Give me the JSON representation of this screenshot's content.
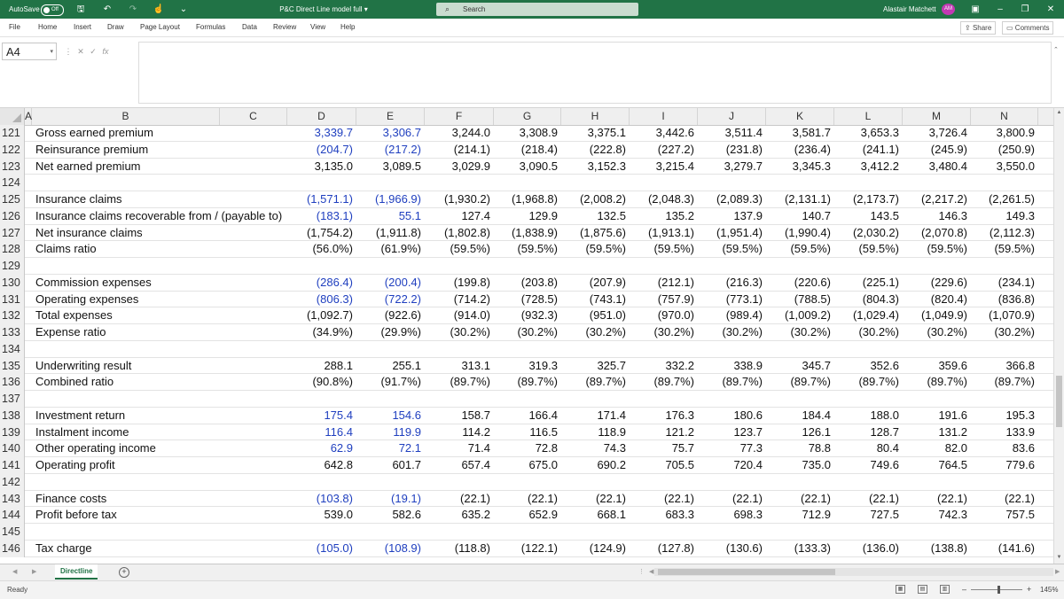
{
  "titlebar": {
    "autosave_label": "AutoSave",
    "autosave_state": "Off",
    "doc_title": "P&C Direct Line model full",
    "doc_title_caret": "▾",
    "search_placeholder": "Search",
    "user_name": "Alastair Matchett",
    "user_initials": "AM"
  },
  "menu": {
    "tabs": [
      "File",
      "Home",
      "Insert",
      "Draw",
      "Page Layout",
      "Formulas",
      "Data",
      "Review",
      "View",
      "Help"
    ],
    "share_label": "Share",
    "comments_label": "Comments"
  },
  "formula_bar": {
    "name_box": "A4",
    "fx_label": "fx",
    "formula_value": ""
  },
  "columns": [
    "A",
    "B",
    "C",
    "D",
    "E",
    "F",
    "G",
    "H",
    "I",
    "J",
    "K",
    "L",
    "M",
    "N"
  ],
  "rows": [
    {
      "n": "121",
      "label": "Gross earned premium",
      "blue": [
        0,
        1
      ],
      "values": [
        "3,339.7",
        "3,306.7",
        "3,244.0",
        "3,308.9",
        "3,375.1",
        "3,442.6",
        "3,511.4",
        "3,581.7",
        "3,653.3",
        "3,726.4",
        "3,800.9"
      ]
    },
    {
      "n": "122",
      "label": "Reinsurance premium",
      "blue": [
        0,
        1
      ],
      "values": [
        "(204.7)",
        "(217.2)",
        "(214.1)",
        "(218.4)",
        "(222.8)",
        "(227.2)",
        "(231.8)",
        "(236.4)",
        "(241.1)",
        "(245.9)",
        "(250.9)"
      ]
    },
    {
      "n": "123",
      "label": "Net earned premium",
      "blue": [],
      "values": [
        "3,135.0",
        "3,089.5",
        "3,029.9",
        "3,090.5",
        "3,152.3",
        "3,215.4",
        "3,279.7",
        "3,345.3",
        "3,412.2",
        "3,480.4",
        "3,550.0"
      ]
    },
    {
      "n": "124",
      "label": "",
      "blue": [],
      "values": []
    },
    {
      "n": "125",
      "label": "Insurance claims",
      "blue": [
        0,
        1
      ],
      "values": [
        "(1,571.1)",
        "(1,966.9)",
        "(1,930.2)",
        "(1,968.8)",
        "(2,008.2)",
        "(2,048.3)",
        "(2,089.3)",
        "(2,131.1)",
        "(2,173.7)",
        "(2,217.2)",
        "(2,261.5)"
      ]
    },
    {
      "n": "126",
      "label": "Insurance claims recoverable from / (payable to)",
      "blue": [
        0,
        1
      ],
      "values": [
        "(183.1)",
        "55.1",
        "127.4",
        "129.9",
        "132.5",
        "135.2",
        "137.9",
        "140.7",
        "143.5",
        "146.3",
        "149.3"
      ]
    },
    {
      "n": "127",
      "label": "Net insurance claims",
      "blue": [],
      "values": [
        "(1,754.2)",
        "(1,911.8)",
        "(1,802.8)",
        "(1,838.9)",
        "(1,875.6)",
        "(1,913.1)",
        "(1,951.4)",
        "(1,990.4)",
        "(2,030.2)",
        "(2,070.8)",
        "(2,112.3)"
      ]
    },
    {
      "n": "128",
      "label": "Claims ratio",
      "blue": [],
      "values": [
        "(56.0%)",
        "(61.9%)",
        "(59.5%)",
        "(59.5%)",
        "(59.5%)",
        "(59.5%)",
        "(59.5%)",
        "(59.5%)",
        "(59.5%)",
        "(59.5%)",
        "(59.5%)"
      ]
    },
    {
      "n": "129",
      "label": "",
      "blue": [],
      "values": []
    },
    {
      "n": "130",
      "label": "Commission expenses",
      "blue": [
        0,
        1
      ],
      "values": [
        "(286.4)",
        "(200.4)",
        "(199.8)",
        "(203.8)",
        "(207.9)",
        "(212.1)",
        "(216.3)",
        "(220.6)",
        "(225.1)",
        "(229.6)",
        "(234.1)"
      ]
    },
    {
      "n": "131",
      "label": "Operating expenses",
      "blue": [
        0,
        1
      ],
      "values": [
        "(806.3)",
        "(722.2)",
        "(714.2)",
        "(728.5)",
        "(743.1)",
        "(757.9)",
        "(773.1)",
        "(788.5)",
        "(804.3)",
        "(820.4)",
        "(836.8)"
      ]
    },
    {
      "n": "132",
      "label": "Total expenses",
      "blue": [],
      "values": [
        "(1,092.7)",
        "(922.6)",
        "(914.0)",
        "(932.3)",
        "(951.0)",
        "(970.0)",
        "(989.4)",
        "(1,009.2)",
        "(1,029.4)",
        "(1,049.9)",
        "(1,070.9)"
      ]
    },
    {
      "n": "133",
      "label": "Expense ratio",
      "blue": [],
      "values": [
        "(34.9%)",
        "(29.9%)",
        "(30.2%)",
        "(30.2%)",
        "(30.2%)",
        "(30.2%)",
        "(30.2%)",
        "(30.2%)",
        "(30.2%)",
        "(30.2%)",
        "(30.2%)"
      ]
    },
    {
      "n": "134",
      "label": "",
      "blue": [],
      "values": []
    },
    {
      "n": "135",
      "label": "Underwriting result",
      "blue": [],
      "values": [
        "288.1",
        "255.1",
        "313.1",
        "319.3",
        "325.7",
        "332.2",
        "338.9",
        "345.7",
        "352.6",
        "359.6",
        "366.8"
      ]
    },
    {
      "n": "136",
      "label": "Combined ratio",
      "blue": [],
      "values": [
        "(90.8%)",
        "(91.7%)",
        "(89.7%)",
        "(89.7%)",
        "(89.7%)",
        "(89.7%)",
        "(89.7%)",
        "(89.7%)",
        "(89.7%)",
        "(89.7%)",
        "(89.7%)"
      ]
    },
    {
      "n": "137",
      "label": "",
      "blue": [],
      "values": []
    },
    {
      "n": "138",
      "label": "Investment return",
      "blue": [
        0,
        1
      ],
      "values": [
        "175.4",
        "154.6",
        "158.7",
        "166.4",
        "171.4",
        "176.3",
        "180.6",
        "184.4",
        "188.0",
        "191.6",
        "195.3"
      ]
    },
    {
      "n": "139",
      "label": "Instalment income",
      "blue": [
        0,
        1
      ],
      "values": [
        "116.4",
        "119.9",
        "114.2",
        "116.5",
        "118.9",
        "121.2",
        "123.7",
        "126.1",
        "128.7",
        "131.2",
        "133.9"
      ]
    },
    {
      "n": "140",
      "label": "Other operating income",
      "blue": [
        0,
        1
      ],
      "values": [
        "62.9",
        "72.1",
        "71.4",
        "72.8",
        "74.3",
        "75.7",
        "77.3",
        "78.8",
        "80.4",
        "82.0",
        "83.6"
      ]
    },
    {
      "n": "141",
      "label": "Operating profit",
      "blue": [],
      "values": [
        "642.8",
        "601.7",
        "657.4",
        "675.0",
        "690.2",
        "705.5",
        "720.4",
        "735.0",
        "749.6",
        "764.5",
        "779.6"
      ]
    },
    {
      "n": "142",
      "label": "",
      "blue": [],
      "values": []
    },
    {
      "n": "143",
      "label": "Finance costs",
      "blue": [
        0,
        1
      ],
      "values": [
        "(103.8)",
        "(19.1)",
        "(22.1)",
        "(22.1)",
        "(22.1)",
        "(22.1)",
        "(22.1)",
        "(22.1)",
        "(22.1)",
        "(22.1)",
        "(22.1)"
      ]
    },
    {
      "n": "144",
      "label": "Profit before tax",
      "blue": [],
      "values": [
        "539.0",
        "582.6",
        "635.2",
        "652.9",
        "668.1",
        "683.3",
        "698.3",
        "712.9",
        "727.5",
        "742.3",
        "757.5"
      ]
    },
    {
      "n": "145",
      "label": "",
      "blue": [],
      "values": []
    },
    {
      "n": "146",
      "label": "Tax charge",
      "blue": [
        0,
        1
      ],
      "values": [
        "(105.0)",
        "(108.9)",
        "(118.8)",
        "(122.1)",
        "(124.9)",
        "(127.8)",
        "(130.6)",
        "(133.3)",
        "(136.0)",
        "(138.8)",
        "(141.6)"
      ]
    }
  ],
  "sheet_tab": "Directline",
  "status": {
    "ready": "Ready",
    "zoom": "145%"
  },
  "colors": {
    "ribbon_green": "#217346",
    "input_blue": "#1f3fbf"
  }
}
